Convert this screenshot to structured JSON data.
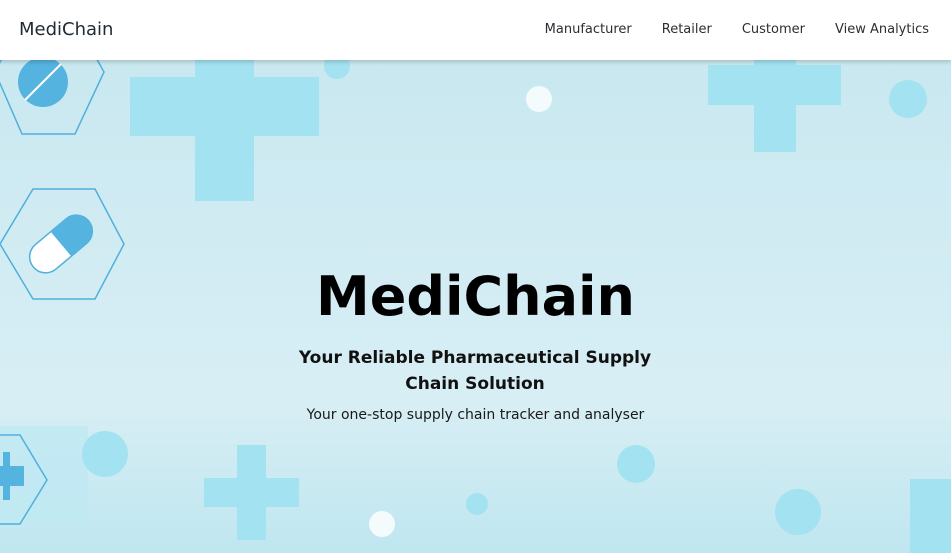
{
  "navbar": {
    "brand": "MediChain",
    "links": [
      "Manufacturer",
      "Retailer",
      "Customer",
      "View Analytics"
    ]
  },
  "hero": {
    "title": "MediChain",
    "subtitle": "Your Reliable Pharmaceutical Supply Chain Solution",
    "description": "Your one-stop supply chain tracker and analyser"
  },
  "colors": {
    "navbar_bg": "#ffffff",
    "hero_bg": "#d3ecf3",
    "deco_cyan": "#a3e2f0",
    "deco_blue": "#4fb0dd",
    "deco_outline": "#4fb0dd",
    "deco_white": "#ffffff"
  },
  "icons": [
    "pill-icon",
    "capsule-icon",
    "medical-cross-icon"
  ]
}
